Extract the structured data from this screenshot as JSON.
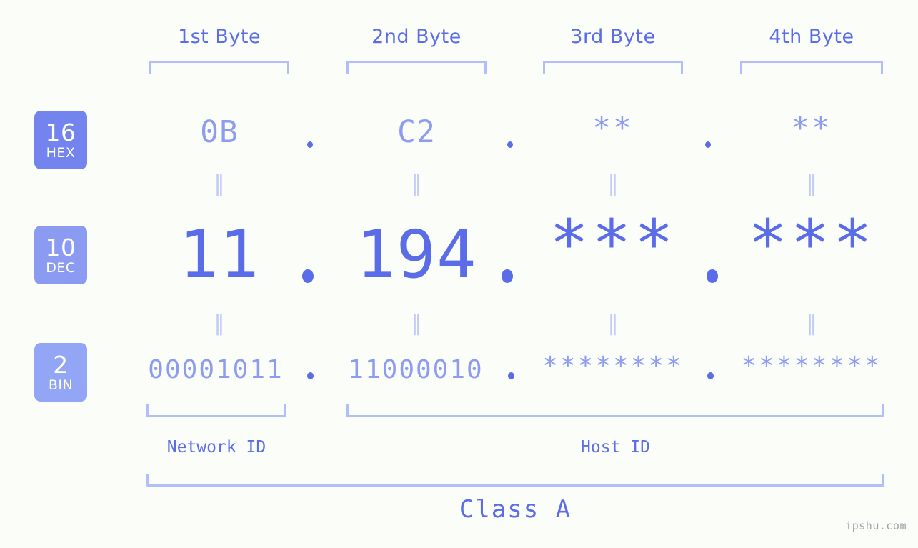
{
  "page": {
    "background_color": "#fbfdf8",
    "accent_color": "#5b6ce8",
    "muted_accent_color": "#8e9cf0",
    "bracket_color": "#b3bdfa"
  },
  "byte_headers": [
    {
      "label": "1st Byte"
    },
    {
      "label": "2nd Byte"
    },
    {
      "label": "3rd Byte"
    },
    {
      "label": "4th Byte"
    }
  ],
  "rows": [
    {
      "badge": {
        "num": "16",
        "abbr": "HEX",
        "color": "#7384ee"
      },
      "octets": [
        "0B",
        "C2",
        "**",
        "**"
      ],
      "separator": "."
    },
    {
      "badge": {
        "num": "10",
        "abbr": "DEC",
        "color": "#8c9bf2"
      },
      "octets": [
        "11",
        "194",
        "***",
        "***"
      ],
      "separator": "."
    },
    {
      "badge": {
        "num": "2",
        "abbr": "BIN",
        "color": "#93a5f5"
      },
      "octets": [
        "00001011",
        "11000010",
        "********",
        "********"
      ],
      "separator": "."
    }
  ],
  "equals_glyph": "‖",
  "ids": [
    {
      "label": "Network ID"
    },
    {
      "label": "Host ID"
    }
  ],
  "class": {
    "label": "Class A"
  },
  "watermark": {
    "text": "ipshu.com"
  }
}
